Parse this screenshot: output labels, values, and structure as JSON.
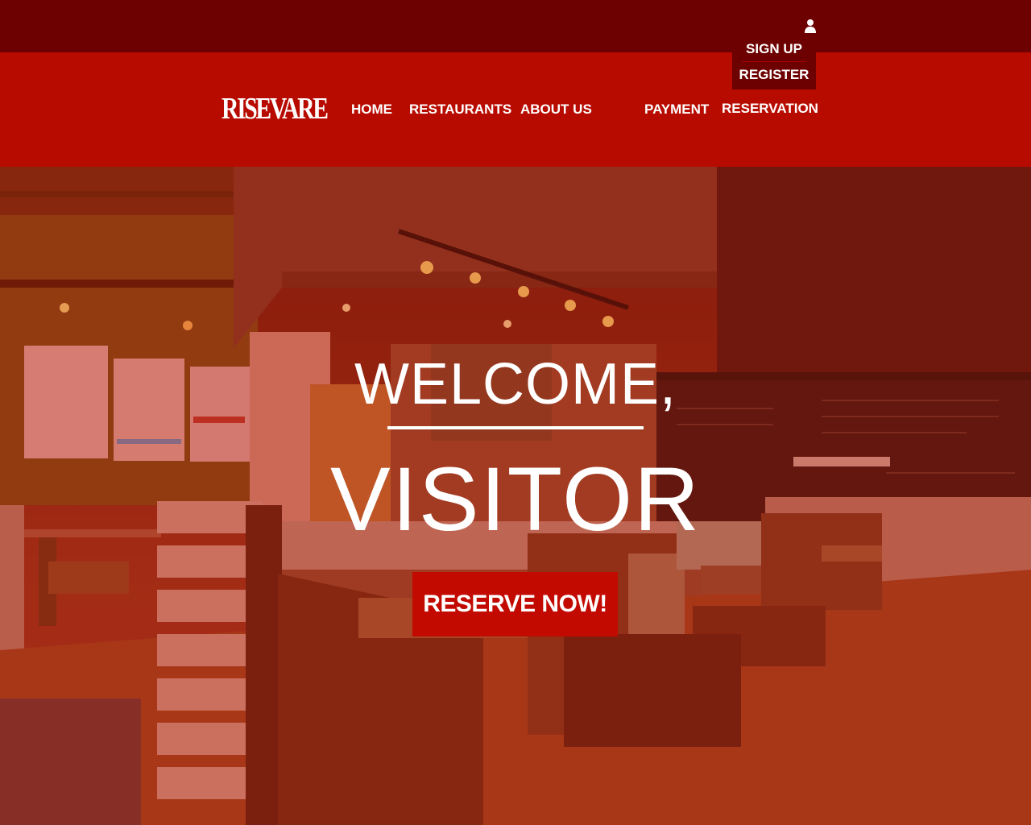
{
  "brand": {
    "logo_text": "RISEVARE"
  },
  "nav": {
    "items": [
      {
        "label": "HOME"
      },
      {
        "label": "RESTAURANTS"
      },
      {
        "label": "ABOUT US"
      },
      {
        "label": "PAYMENT"
      },
      {
        "label": "RESERVATION"
      }
    ]
  },
  "account": {
    "icon": "user-icon",
    "menu": [
      {
        "label": "SIGN UP"
      },
      {
        "label": "REGISTER"
      }
    ]
  },
  "hero": {
    "line1": "WELCOME,",
    "line2": "VISITOR",
    "cta_label": "RESERVE NOW!"
  },
  "colors": {
    "top_bar": "#6d0000",
    "nav_band": "#b80b00",
    "cta": "#c20a00",
    "text": "#ffffff"
  }
}
